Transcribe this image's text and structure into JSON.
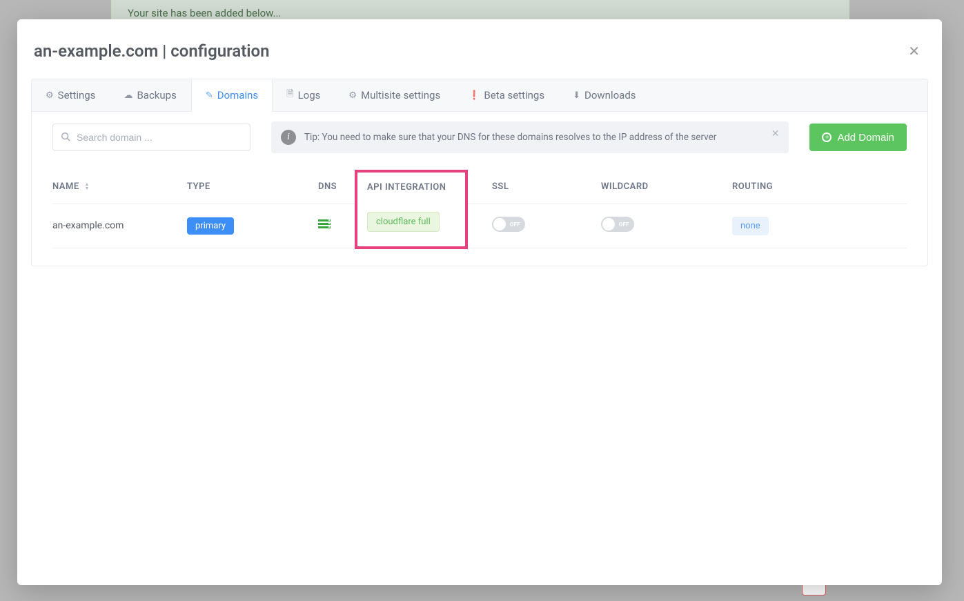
{
  "backgroundBanner": "Your site has been added below...",
  "modal": {
    "title": "an-example.com | configuration"
  },
  "tabs": [
    {
      "label": "Settings",
      "icon": "⚙"
    },
    {
      "label": "Backups",
      "icon": "☁"
    },
    {
      "label": "Domains",
      "icon": "✎",
      "active": true
    },
    {
      "label": "Logs",
      "icon": "🗎"
    },
    {
      "label": "Multisite settings",
      "icon": "⚙"
    },
    {
      "label": "Beta settings",
      "icon": "❗"
    },
    {
      "label": "Downloads",
      "icon": "⬇"
    }
  ],
  "search": {
    "placeholder": "Search domain ..."
  },
  "tip": "Tip: You need to make sure that your DNS for these domains resolves to the IP address of the server",
  "addDomain": "Add Domain",
  "columns": {
    "name": "NAME",
    "type": "TYPE",
    "dns": "DNS",
    "api": "API INTEGRATION",
    "ssl": "SSL",
    "wildcard": "WILDCARD",
    "routing": "ROUTING"
  },
  "toggleOffLabel": "OFF",
  "rows": [
    {
      "name": "an-example.com",
      "type": "primary",
      "api": "cloudflare full",
      "routing": "none"
    }
  ]
}
